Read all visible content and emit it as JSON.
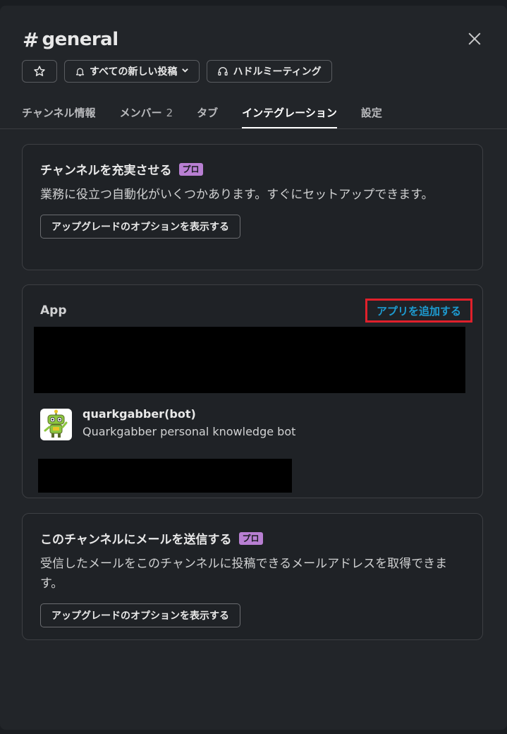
{
  "header": {
    "hash": "#",
    "title": "general"
  },
  "actions": {
    "notify_label": "すべての新しい投稿",
    "huddle_label": "ハドルミーティング"
  },
  "tabs": [
    {
      "label": "チャンネル情報"
    },
    {
      "label": "メンバー",
      "count": "2"
    },
    {
      "label": "タブ"
    },
    {
      "label": "インテグレーション"
    },
    {
      "label": "設定"
    }
  ],
  "cards": {
    "enrich": {
      "title": "チャンネルを充実させる",
      "badge": "プロ",
      "description": "業務に役立つ自動化がいくつかあります。すぐにセットアップできます。",
      "button": "アップグレードのオプションを表示する"
    },
    "apps": {
      "label": "App",
      "add_link": "アプリを追加する",
      "items": [
        {
          "name": "quarkgabber(bot)",
          "description": "Quarkgabber personal knowledge bot"
        }
      ]
    },
    "email": {
      "title": "このチャンネルにメールを送信する",
      "badge": "プロ",
      "description": "受信したメールをこのチャンネルに投稿できるメールアドレスを取得できます。",
      "button": "アップグレードのオプションを表示する"
    }
  },
  "colors": {
    "background": "#222529",
    "accent_link": "#1d9bd1",
    "pro_badge": "#b87fd2",
    "highlight_box": "#e0202b"
  }
}
